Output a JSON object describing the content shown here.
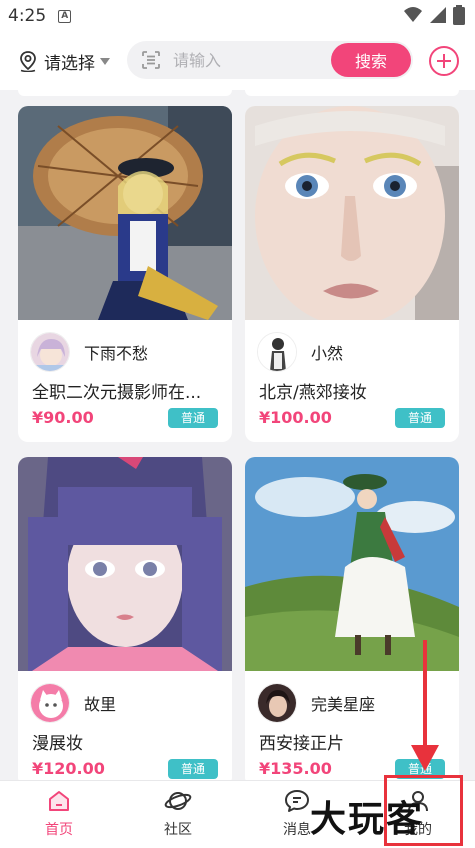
{
  "status_bar": {
    "time": "4:25",
    "notification_letter": "A"
  },
  "header": {
    "location_label": "请选择",
    "search_placeholder": "请输入",
    "search_button": "搜索"
  },
  "cards": [
    {
      "author": "下雨不愁",
      "title": "全职二次元摄影师在...",
      "price": "¥90.00",
      "badge": "普通"
    },
    {
      "author": "小然",
      "title": "北京/燕郊接妆",
      "price": "¥100.00",
      "badge": "普通"
    },
    {
      "author": "故里",
      "title": "漫展妆",
      "price": "¥120.00",
      "badge": "普通"
    },
    {
      "author": "完美星座",
      "title": "西安接正片",
      "price": "¥135.00",
      "badge": "普通"
    }
  ],
  "bottom_nav": {
    "items": [
      {
        "label": "首页",
        "icon": "home-icon",
        "active": true
      },
      {
        "label": "社区",
        "icon": "planet-icon",
        "active": false
      },
      {
        "label": "消息",
        "icon": "chat-icon",
        "active": false
      },
      {
        "label": "我的",
        "icon": "profile-icon",
        "active": false
      }
    ]
  },
  "watermark": "大玩客",
  "colors": {
    "accent": "#f2457a",
    "badge": "#3fc0c7",
    "annotation": "#e8323c"
  }
}
